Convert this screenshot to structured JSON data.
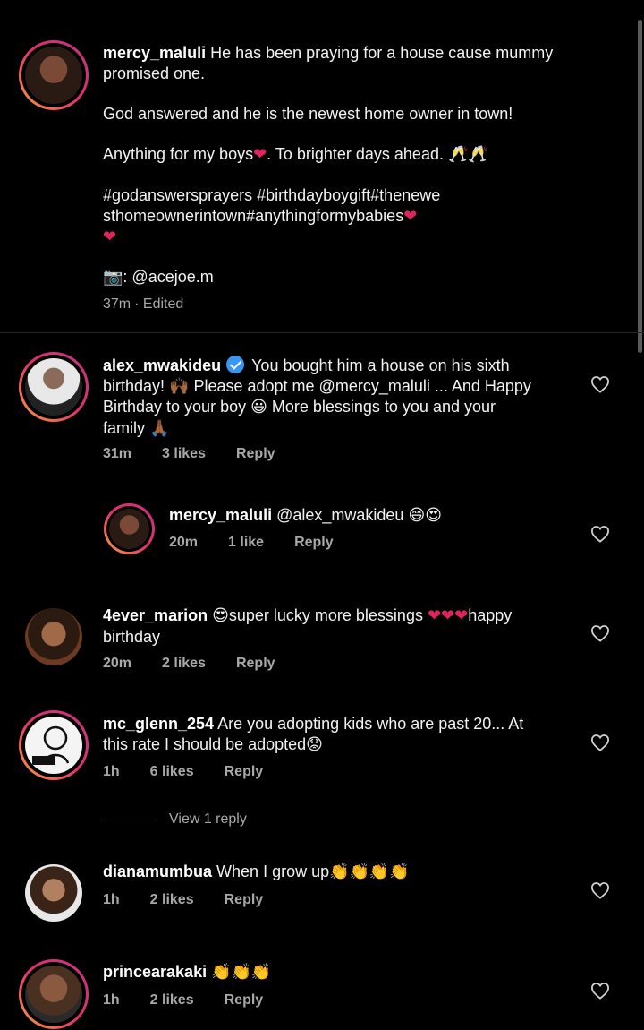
{
  "caption": {
    "username": "mercy_maluli",
    "line1": "He has been praying for a house cause mummy promised one.",
    "line2": "God answered and he is the newest home owner in town!",
    "line3a": "Anything for my boys",
    "line3b": ". To brighter days ahead.",
    "hashtags_a": "#godanswersprayers #birthdayboygift#thenewe",
    "hashtags_b": "sthomeownerintown#anythingformybabies",
    "credit": ": @acejoe.m",
    "time": "37m",
    "edited": "· Edited"
  },
  "comments": [
    {
      "username": "alex_mwakideu",
      "verified": true,
      "text_a": "You bought him a house on his sixth",
      "text_b": "birthday! ",
      "text_c": " Please adopt me @mercy_maluli ... And Happy",
      "text_d": "Birthday to your boy ",
      "text_e": " More blessings to you and your",
      "text_f": "family ",
      "time": "31m",
      "likes": "3 likes",
      "reply": "Reply"
    },
    {
      "username": "mercy_maluli",
      "text": "@alex_mwakideu",
      "time": "20m",
      "likes": "1 like",
      "reply": "Reply"
    },
    {
      "username": "4ever_marion",
      "text_a": "super lucky more blessings ",
      "text_b": "happy",
      "text_c": "birthday",
      "time": "20m",
      "likes": "2 likes",
      "reply": "Reply"
    },
    {
      "username": "mc_glenn_254",
      "text_a": "Are you adopting kids who are past 20... At",
      "text_b": "this rate I should be adopted",
      "time": "1h",
      "likes": "6 likes",
      "reply": "Reply",
      "view_replies": "View 1 reply"
    },
    {
      "username": "dianamumbua",
      "text": "When I grow up",
      "time": "1h",
      "likes": "2 likes",
      "reply": "Reply"
    },
    {
      "username": "princearakaki",
      "time": "1h",
      "likes": "2 likes",
      "reply": "Reply"
    }
  ],
  "colors": {
    "background": "#000000",
    "secondary_text": "#a8a8a8",
    "heart": "#e0245e",
    "verified": "#3897f0"
  }
}
